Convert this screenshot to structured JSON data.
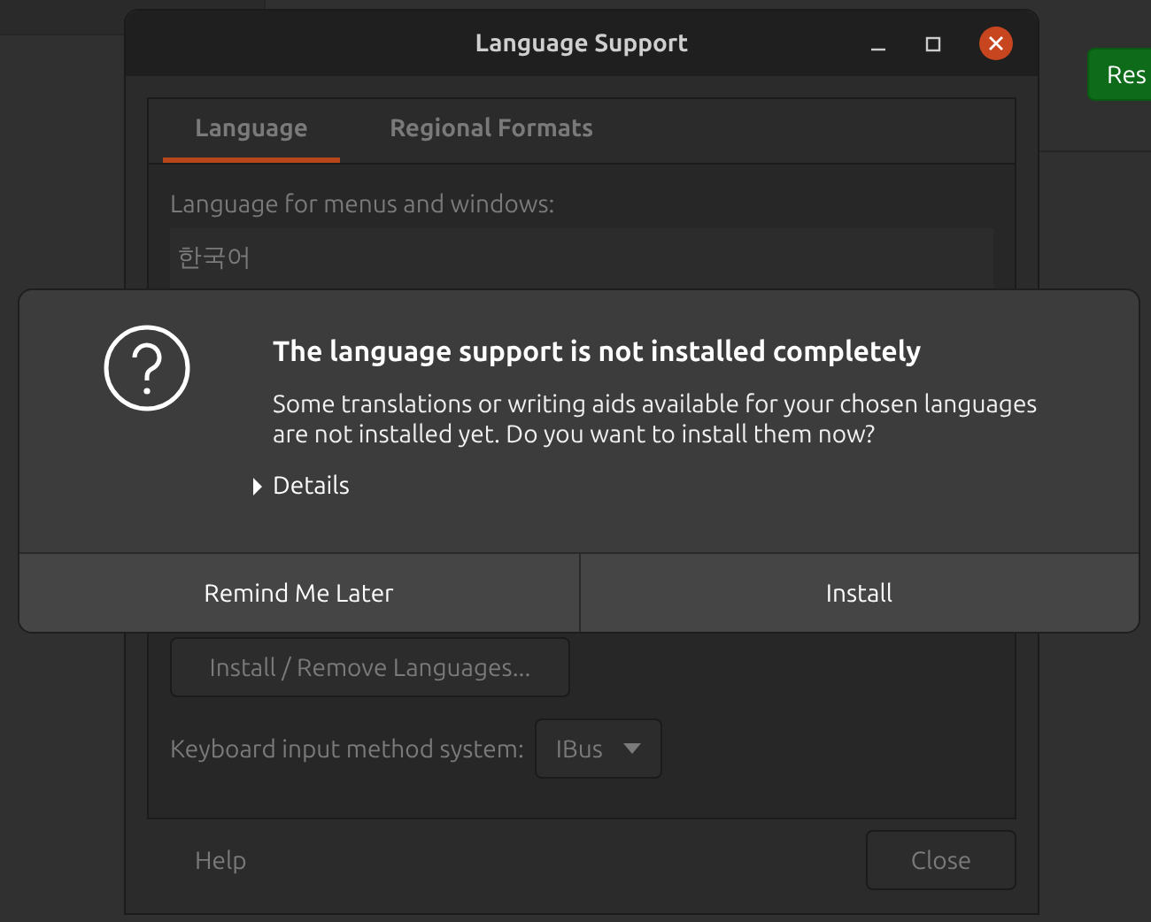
{
  "background_app": {
    "button": "Res"
  },
  "window": {
    "title": "Language Support",
    "tabs": [
      {
        "label": "Language",
        "selected": true
      },
      {
        "label": "Regional Formats",
        "selected": false
      }
    ],
    "language_label": "Language for menus and windows:",
    "languages": [
      "한국어"
    ],
    "install_button": "Install / Remove Languages...",
    "input_method": {
      "label": "Keyboard input method system:",
      "value": "IBus"
    },
    "help_button": "Help",
    "close_button": "Close"
  },
  "dialog": {
    "heading": "The language support is not installed completely",
    "message": "Some translations or writing aids available for your chosen languages are not installed yet. Do you want to install them now?",
    "details": {
      "label": "Details",
      "expanded": false
    },
    "buttons": [
      "Remind Me Later",
      "Install"
    ]
  }
}
